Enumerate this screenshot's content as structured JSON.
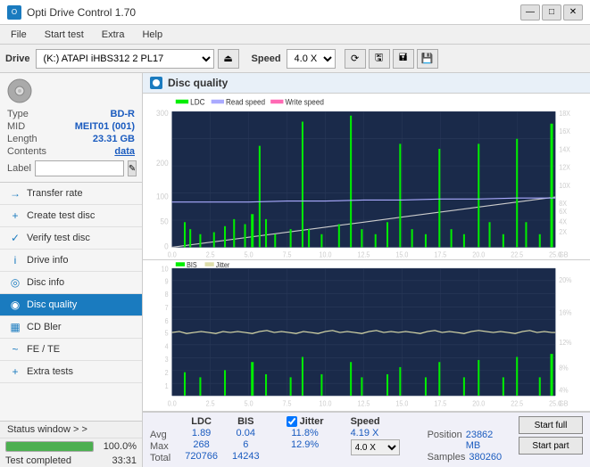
{
  "titlebar": {
    "title": "Opti Drive Control 1.70",
    "icon": "O",
    "controls": [
      "—",
      "□",
      "✕"
    ]
  },
  "menubar": {
    "items": [
      "File",
      "Start test",
      "Extra",
      "Help"
    ]
  },
  "drivebar": {
    "label": "Drive",
    "drive_value": "(K:) ATAPI iHBS312  2 PL17",
    "speed_label": "Speed",
    "speed_value": "4.0 X"
  },
  "disc": {
    "type_label": "Type",
    "type_value": "BD-R",
    "mid_label": "MID",
    "mid_value": "MEIT01 (001)",
    "length_label": "Length",
    "length_value": "23.31 GB",
    "contents_label": "Contents",
    "contents_value": "data",
    "label_label": "Label",
    "label_value": ""
  },
  "nav": {
    "items": [
      {
        "id": "transfer-rate",
        "label": "Transfer rate",
        "icon": "→"
      },
      {
        "id": "create-test-disc",
        "label": "Create test disc",
        "icon": "+"
      },
      {
        "id": "verify-test-disc",
        "label": "Verify test disc",
        "icon": "✓"
      },
      {
        "id": "drive-info",
        "label": "Drive info",
        "icon": "i"
      },
      {
        "id": "disc-info",
        "label": "Disc info",
        "icon": "📀"
      },
      {
        "id": "disc-quality",
        "label": "Disc quality",
        "icon": "◉",
        "active": true
      },
      {
        "id": "cd-bler",
        "label": "CD Bler",
        "icon": "▦"
      },
      {
        "id": "fe-te",
        "label": "FE / TE",
        "icon": "~"
      },
      {
        "id": "extra-tests",
        "label": "Extra tests",
        "icon": "+"
      }
    ]
  },
  "disc_quality": {
    "title": "Disc quality"
  },
  "chart1": {
    "legend": [
      "LDC",
      "Read speed",
      "Write speed"
    ],
    "legend_colors": [
      "#00cc00",
      "#aaaaff",
      "#ff69b4"
    ],
    "y_labels": [
      "300",
      "200",
      "100",
      "50",
      "0"
    ],
    "y_labels_right": [
      "18X",
      "16X",
      "14X",
      "12X",
      "10X",
      "8X",
      "6X",
      "4X",
      "2X"
    ],
    "x_labels": [
      "0.0",
      "2.5",
      "5.0",
      "7.5",
      "10.0",
      "12.5",
      "15.0",
      "17.5",
      "20.0",
      "22.5",
      "25.0"
    ]
  },
  "chart2": {
    "legend": [
      "BIS",
      "Jitter"
    ],
    "legend_colors": [
      "#00cc00",
      "#dddd00"
    ],
    "y_labels": [
      "10",
      "9",
      "8",
      "7",
      "6",
      "5",
      "4",
      "3",
      "2",
      "1"
    ],
    "y_labels_right": [
      "20%",
      "16%",
      "12%",
      "8%",
      "4%"
    ],
    "x_labels": [
      "0.0",
      "2.5",
      "5.0",
      "7.5",
      "10.0",
      "12.5",
      "15.0",
      "17.5",
      "20.0",
      "22.5",
      "25.0"
    ]
  },
  "stats": {
    "col_headers": [
      "LDC",
      "BIS",
      "",
      "Jitter",
      "Speed"
    ],
    "avg_label": "Avg",
    "max_label": "Max",
    "total_label": "Total",
    "ldc_avg": "1.89",
    "ldc_max": "268",
    "ldc_total": "720766",
    "bis_avg": "0.04",
    "bis_max": "6",
    "bis_total": "14243",
    "jitter_avg": "11.8%",
    "jitter_max": "12.9%",
    "speed_label": "Speed",
    "speed_val": "4.19 X",
    "speed_dropdown": "4.0 X",
    "position_label": "Position",
    "position_val": "23862 MB",
    "samples_label": "Samples",
    "samples_val": "380260",
    "btn_start_full": "Start full",
    "btn_start_part": "Start part"
  },
  "status": {
    "nav_label": "Status window > >",
    "progress_pct": "100.0%",
    "progress_value": 100,
    "status_text": "Test completed",
    "time": "33:31"
  }
}
